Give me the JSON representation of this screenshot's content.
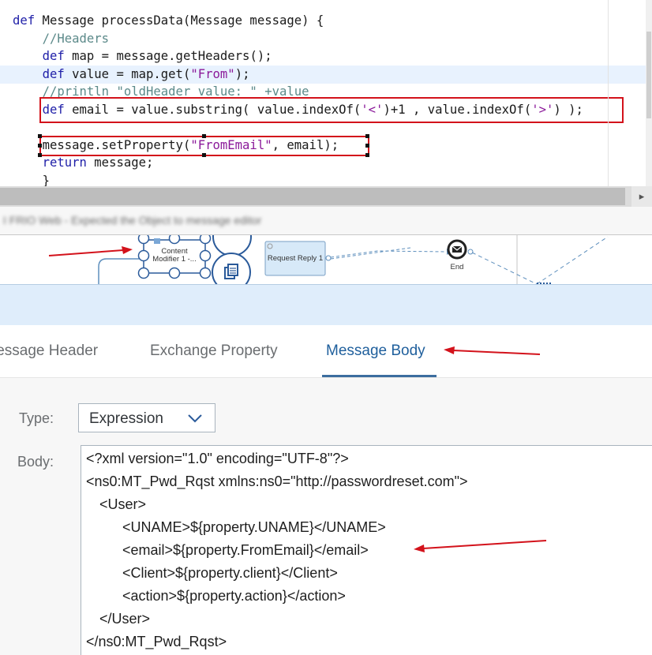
{
  "code": {
    "lines": [
      {
        "c1": "def",
        "c2": " Message processData(Message message) {"
      },
      {
        "c1": "//Headers"
      },
      {
        "c1": "def",
        "c2": " map = message.getHeaders();"
      },
      {
        "c1": "def",
        "c2": " value = map.get(",
        "c3": "\"From\"",
        "c4": ");"
      },
      {
        "c1": "//println \"oldHeader value: \" +value"
      },
      {
        "c1": "def",
        "c2": " email = value.substring( value.indexOf(",
        "c3": "'<'",
        "c4": ")+1 , value.indexOf(",
        "c5": "'>'",
        "c6": ") );"
      },
      {
        "c1": ""
      },
      {
        "c2": "message.setProperty(",
        "c3": "\"FromEmail\"",
        "c4": ", email);"
      },
      {
        "c1": "return",
        "c2": " message;"
      },
      {
        "c2": "}"
      }
    ]
  },
  "blurred_message": "I FRIO Web - Expected the Object to message editor",
  "iflow": {
    "content_modifier_label_1": "Content",
    "content_modifier_label_2": "Modifier 1 -...",
    "request_reply_label": "Request Reply 1",
    "end_label": "End"
  },
  "tabs": {
    "message_header": "lessage Header",
    "exchange_property": "Exchange Property",
    "message_body": "Message Body"
  },
  "form": {
    "type_label": "Type:",
    "type_value": "Expression",
    "body_label": "Body:"
  },
  "body_lines": [
    "<?xml version=\"1.0\" encoding=\"UTF-8\"?>",
    "<ns0:MT_Pwd_Rqst xmlns:ns0=\"http://passwordreset.com\">",
    "<User>",
    "<UNAME>${property.UNAME}</UNAME>",
    "<email>${property.FromEmail}</email>",
    "<Client>${property.client}</Client>",
    "<action>${property.action}</action>",
    "</User>",
    "</ns0:MT_Pwd_Rqst>"
  ],
  "colors": {
    "highlight_red": "#d3121b",
    "tab_active": "#1f5f9c",
    "keyword": "#1f1fa8",
    "string": "#8b1a9a",
    "comment": "#5c8a8a"
  }
}
